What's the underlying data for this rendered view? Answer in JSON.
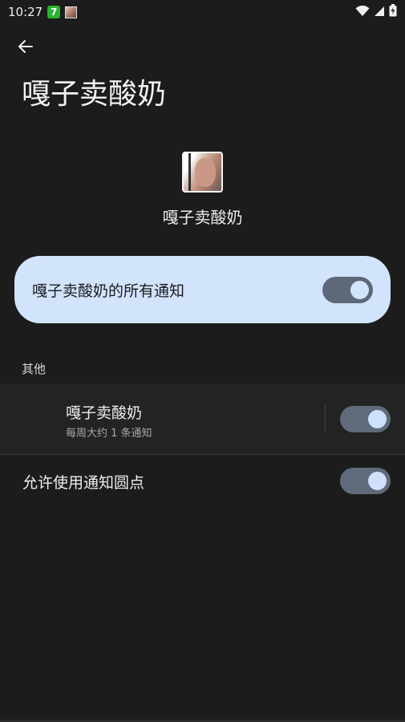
{
  "status_bar": {
    "time": "10:27",
    "badge": "7",
    "icons": [
      "wifi-icon",
      "signal-icon",
      "battery-charging-icon"
    ]
  },
  "header": {
    "back_icon": "arrow-back-icon",
    "title": "嘎子卖酸奶"
  },
  "app": {
    "name": "嘎子卖酸奶"
  },
  "master_toggle": {
    "label": "嘎子卖酸奶的所有通知",
    "checked": true
  },
  "sections": [
    {
      "header": "其他",
      "channels": [
        {
          "title": "嘎子卖酸奶",
          "subtitle": "每周大约 1 条通知",
          "checked": true
        }
      ]
    }
  ],
  "dot_setting": {
    "label": "允许使用通知圆点",
    "checked": true
  },
  "colors": {
    "background": "#1c1c1c",
    "accent_card": "#d2e3fc",
    "switch_track": "#5f6b7a",
    "switch_thumb": "#cfe0fb"
  }
}
